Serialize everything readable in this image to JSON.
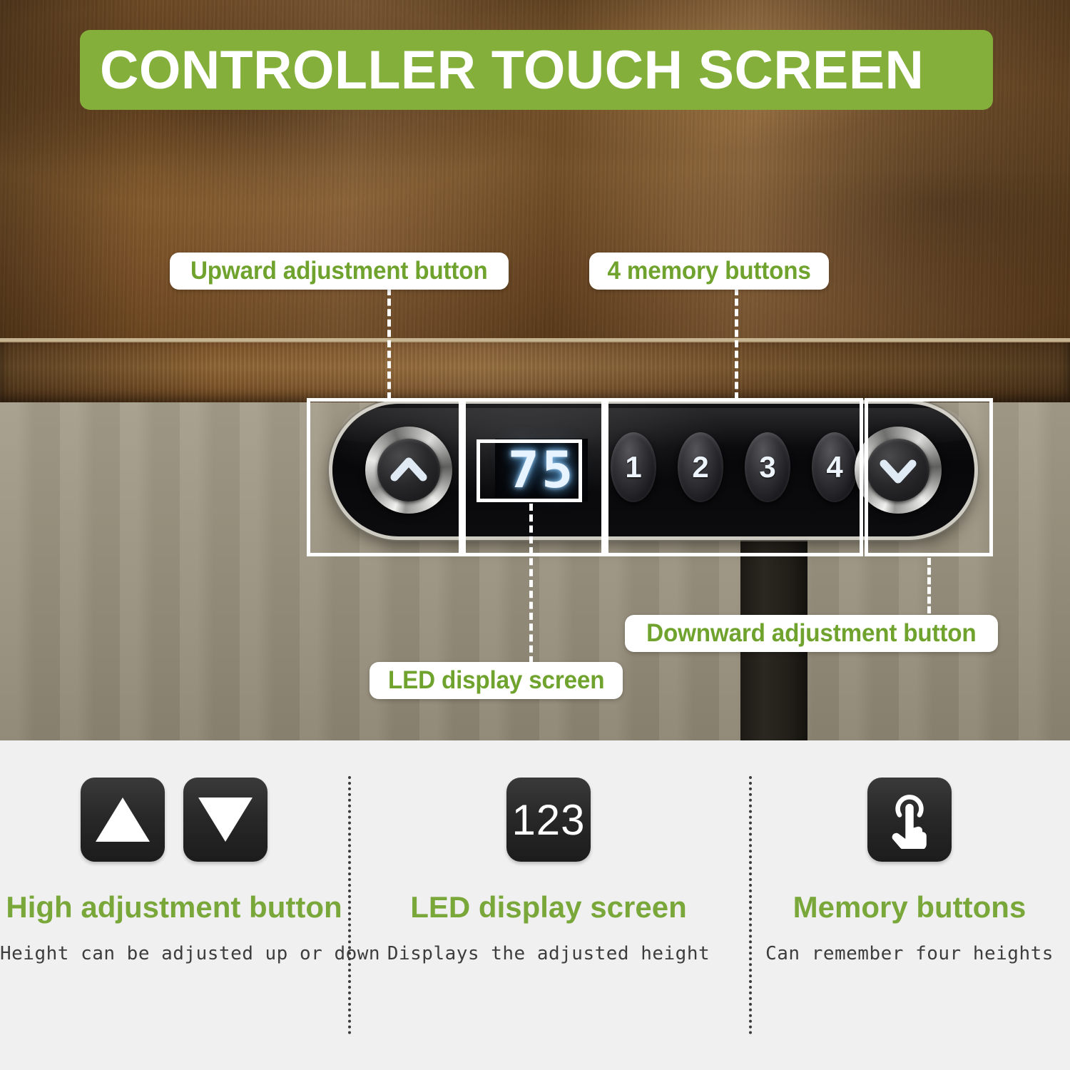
{
  "banner": {
    "title": "CONTROLLER TOUCH SCREEN",
    "color": "#84af3b"
  },
  "accent": {
    "green_text": "#7aa73a",
    "panel_bg": "#f0f0f0"
  },
  "photo": {
    "callouts": [
      {
        "id": "upward-adjustment",
        "label": "Upward adjustment button"
      },
      {
        "id": "memory-buttons",
        "label": "4 memory buttons"
      },
      {
        "id": "led-display",
        "label": "LED display screen"
      },
      {
        "id": "downward-adjustment",
        "label": "Downward adjustment button"
      }
    ]
  },
  "controller": {
    "up_button_icon": "chevron-up-icon",
    "down_button_icon": "chevron-down-icon",
    "led_value": "75",
    "memory_buttons": [
      {
        "label": "1"
      },
      {
        "label": "2"
      },
      {
        "label": "3"
      },
      {
        "label": "4"
      }
    ]
  },
  "features": [
    {
      "id": "high-adjustment",
      "icons": [
        "triangle-up-icon",
        "triangle-down-icon"
      ],
      "title": "High adjustment button",
      "description": "Height can be adjusted up or down"
    },
    {
      "id": "led-display",
      "icons": [
        "numeric-123-icon"
      ],
      "icon_text": "123",
      "title": "LED display screen",
      "description": "Displays the adjusted height"
    },
    {
      "id": "memory-buttons",
      "icons": [
        "touch-hand-icon"
      ],
      "title": "Memory buttons",
      "description": "Can remember four heights"
    }
  ]
}
